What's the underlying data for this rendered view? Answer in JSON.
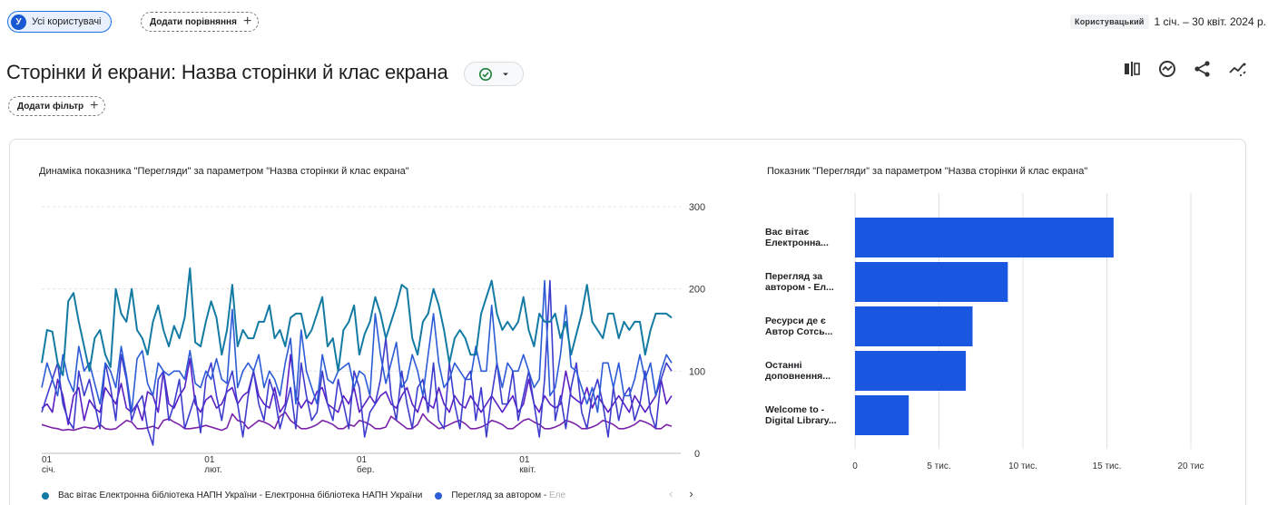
{
  "top": {
    "segment_avatar": "У",
    "segment_label": "Усі користувачі",
    "add_comparison_label": "Додати порівняння",
    "date_type": "Користувацький",
    "date_range": "1 січ. – 30 квіт. 2024 р."
  },
  "report": {
    "title": "Сторінки й екрани: Назва сторінки й клас екрана",
    "add_filter_label": "Додати фільтр",
    "status_color": "#188038"
  },
  "icons": [
    "compare-icon",
    "insights-icon",
    "share-icon",
    "trend-icon"
  ],
  "line_card": {
    "title": "Динаміка показника \"Перегляди\" за параметром \"Назва сторінки й клас екрана\""
  },
  "bar_card": {
    "title": "Показник \"Перегляди\" за параметром \"Назва сторінки й клас екрана\""
  },
  "legend": {
    "item1": "Вас вітає Електронна бібліотека НАПН України - Електронна бібліотека НАПН України",
    "item2": "Перегляд за автором - ",
    "item2_fade": "Еле"
  },
  "colors": {
    "series1": "#137ba3",
    "series2": "#2c5bd6",
    "series3": "#3d3ccc",
    "series4": "#5a1fc4",
    "series5": "#7a23a8",
    "bar": "#1a57e0"
  },
  "chart_data": [
    {
      "type": "line",
      "title": "Динаміка показника \"Перегляди\" за параметром \"Назва сторінки й клас екрана\"",
      "x_ticks": [
        {
          "label": "01",
          "sub": "січ.",
          "day": 0
        },
        {
          "label": "01",
          "sub": "лют.",
          "day": 31
        },
        {
          "label": "01",
          "sub": "бер.",
          "day": 60
        },
        {
          "label": "01",
          "sub": "квіт.",
          "day": 91
        }
      ],
      "y_ticks": [
        0,
        100,
        200,
        300
      ],
      "ylim": [
        0,
        300
      ],
      "grid": true,
      "series": [
        {
          "values": [
            110,
            150,
            148,
            110,
            95,
            185,
            195,
            160,
            130,
            100,
            140,
            150,
            120,
            105,
            200,
            170,
            160,
            200,
            150,
            140,
            120,
            160,
            180,
            150,
            130,
            155,
            140,
            165,
            225,
            135,
            130,
            160,
            185,
            165,
            120,
            150,
            205,
            130,
            150,
            140,
            140,
            160,
            160,
            180,
            140,
            150,
            130,
            165,
            170,
            170,
            140,
            150,
            170,
            190,
            130,
            140,
            100,
            150,
            160,
            180,
            120,
            145,
            160,
            190,
            170,
            140,
            160,
            180,
            205,
            200,
            140,
            120,
            160,
            170,
            200,
            180,
            150,
            110,
            140,
            150,
            140,
            120,
            120,
            170,
            190,
            210,
            170,
            150,
            160,
            150,
            160,
            190,
            150,
            130,
            170,
            160,
            160,
            170,
            140,
            160,
            120,
            145,
            170,
            205,
            160,
            150,
            140,
            170,
            170,
            140,
            160,
            150,
            160,
            160,
            120,
            150,
            170,
            170,
            170,
            165
          ]
        },
        {
          "values": [
            80,
            110,
            90,
            70,
            120,
            90,
            75,
            130,
            100,
            110,
            85,
            60,
            110,
            100,
            80,
            130,
            95,
            50,
            115,
            125,
            85,
            70,
            110,
            100,
            95,
            100,
            100,
            90,
            125,
            85,
            80,
            100,
            90,
            115,
            90,
            85,
            175,
            80,
            100,
            110,
            100,
            120,
            80,
            100,
            90,
            70,
            110,
            140,
            60,
            150,
            100,
            80,
            60,
            120,
            90,
            85,
            100,
            105,
            110,
            80,
            100,
            95,
            70,
            170,
            120,
            85,
            110,
            135,
            80,
            90,
            120,
            100,
            70,
            120,
            170,
            110,
            80,
            90,
            110,
            100,
            90,
            90,
            130,
            100,
            100,
            180,
            110,
            80,
            110,
            100,
            100,
            120,
            100,
            80,
            90,
            210,
            70,
            80,
            120,
            180,
            105,
            100,
            80,
            60,
            80,
            50,
            110,
            110,
            80,
            110,
            70,
            70,
            90,
            120,
            90,
            110,
            70,
            100,
            120,
            110
          ]
        },
        {
          "values": [
            50,
            70,
            90,
            110,
            60,
            40,
            30,
            100,
            70,
            90,
            60,
            30,
            110,
            80,
            40,
            120,
            90,
            40,
            60,
            70,
            30,
            10,
            90,
            100,
            40,
            60,
            90,
            30,
            50,
            70,
            25,
            90,
            110,
            70,
            40,
            80,
            100,
            60,
            20,
            70,
            100,
            60,
            40,
            90,
            70,
            30,
            55,
            80,
            30,
            110,
            70,
            40,
            50,
            100,
            60,
            40,
            90,
            60,
            30,
            100,
            80,
            20,
            50,
            60,
            90,
            140,
            70,
            40,
            100,
            60,
            30,
            80,
            90,
            50,
            110,
            40,
            30,
            110,
            60,
            30,
            90,
            100,
            40,
            80,
            20,
            70,
            110,
            60,
            60,
            100,
            40,
            70,
            100,
            60,
            20,
            90,
            210,
            40,
            70,
            30,
            80,
            110,
            50,
            30,
            70,
            90,
            60,
            20,
            80,
            40,
            70,
            80,
            40,
            60,
            100,
            50,
            30,
            90,
            110,
            100
          ]
        },
        {
          "values": [
            55,
            60,
            50,
            90,
            70,
            35,
            70,
            80,
            40,
            65,
            55,
            50,
            80,
            70,
            60,
            85,
            55,
            50,
            60,
            40,
            75,
            70,
            50,
            100,
            60,
            55,
            70,
            80,
            115,
            60,
            50,
            65,
            70,
            55,
            60,
            75,
            80,
            60,
            70,
            75,
            100,
            70,
            60,
            55,
            80,
            50,
            60,
            120,
            70,
            55,
            65,
            60,
            75,
            80,
            60,
            55,
            50,
            70,
            60,
            80,
            50,
            60,
            70,
            60,
            70,
            75,
            60,
            55,
            70,
            80,
            60,
            50,
            70,
            60,
            55,
            80,
            60,
            50,
            70,
            60,
            55,
            70,
            60,
            50,
            60,
            70,
            60,
            50,
            60,
            70,
            50,
            60,
            90,
            60,
            50,
            70,
            60,
            55,
            60,
            100,
            70,
            65,
            60,
            80,
            55,
            70,
            60,
            50,
            60,
            70,
            60,
            50,
            70,
            60,
            50,
            60,
            70,
            90,
            60,
            70
          ]
        },
        {
          "values": [
            35,
            33,
            31,
            30,
            28,
            29,
            28,
            30,
            32,
            31,
            30,
            35,
            30,
            29,
            30,
            35,
            40,
            38,
            30,
            30,
            31,
            33,
            30,
            40,
            42,
            38,
            35,
            30,
            30,
            31,
            32,
            34,
            32,
            30,
            28,
            31,
            48,
            40,
            38,
            30,
            35,
            40,
            38,
            35,
            30,
            45,
            50,
            40,
            35,
            30,
            30,
            32,
            35,
            40,
            38,
            35,
            30,
            30,
            35,
            33,
            40,
            38,
            35,
            30,
            30,
            32,
            45,
            40,
            35,
            30,
            30,
            35,
            48,
            40,
            35,
            30,
            32,
            35,
            38,
            40,
            36,
            30,
            30,
            32,
            35,
            40,
            38,
            35,
            30,
            30,
            35,
            40,
            42,
            38,
            35,
            30,
            30,
            32,
            35,
            40,
            38,
            35,
            30,
            30,
            32,
            35,
            40,
            38,
            35,
            30,
            30,
            32,
            35,
            40,
            38,
            35,
            30,
            30,
            35,
            33
          ]
        }
      ]
    },
    {
      "type": "bar",
      "title": "Показник \"Перегляди\" за параметром \"Назва сторінки й клас екрана\"",
      "categories": [
        [
          "Вас вітає",
          "Електронна..."
        ],
        [
          "Перегляд за",
          "автором - Ел..."
        ],
        [
          "Ресурси де є",
          "Автор Сотсь..."
        ],
        [
          "Останні",
          "доповнення..."
        ],
        [
          "Welcome to -",
          "Digital Library..."
        ]
      ],
      "values": [
        15400,
        9100,
        7000,
        6600,
        3200
      ],
      "x_ticks": [
        "0",
        "5 тис.",
        "10 тис.",
        "15 тис.",
        "20 тис"
      ],
      "xlim": [
        0,
        20000
      ],
      "grid": true
    }
  ]
}
